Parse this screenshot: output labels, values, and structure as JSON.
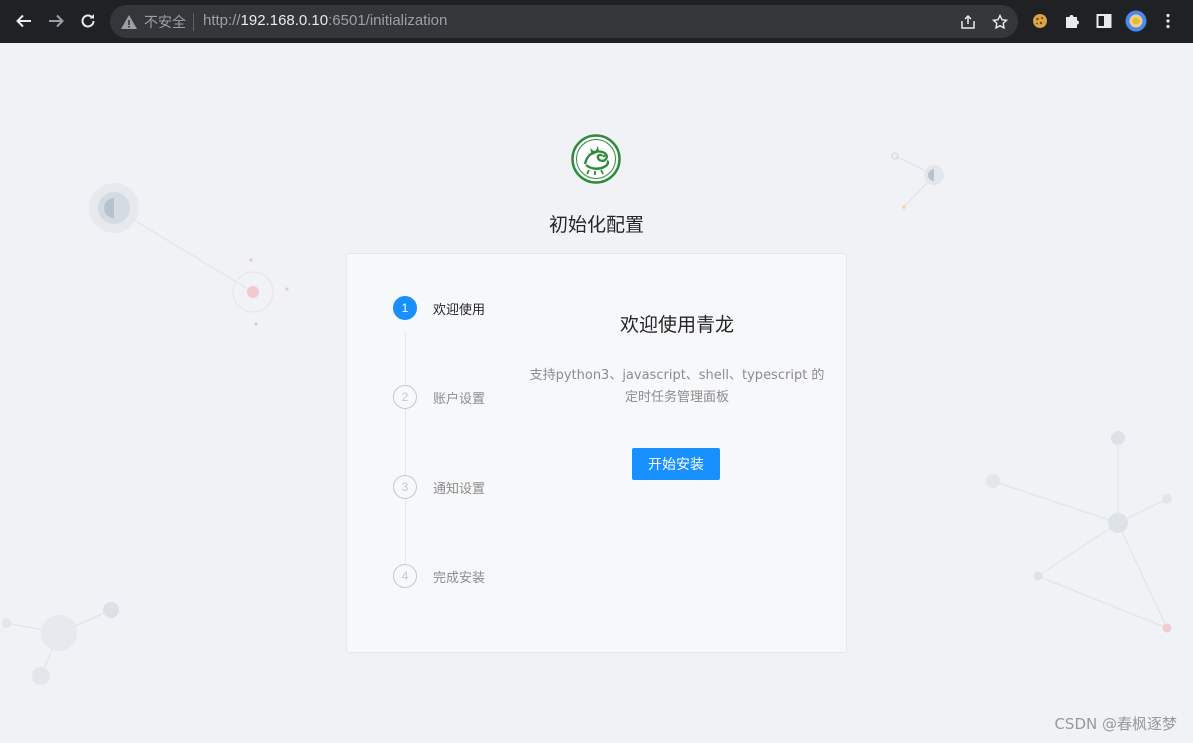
{
  "browser": {
    "security_label": "不安全",
    "url_prefix": "http://",
    "url_host": "192.168.0.10",
    "url_rest": ":6501/initialization"
  },
  "page": {
    "title": "初始化配置",
    "steps": [
      {
        "number": "1",
        "label": "欢迎使用",
        "active": true
      },
      {
        "number": "2",
        "label": "账户设置",
        "active": false
      },
      {
        "number": "3",
        "label": "通知设置",
        "active": false
      },
      {
        "number": "4",
        "label": "完成安装",
        "active": false
      }
    ],
    "welcome_title": "欢迎使用青龙",
    "description_line1": "支持python3、javascript、shell、typescript 的",
    "description_line2": "定时任务管理面板",
    "start_button": "开始安装"
  },
  "watermark": "CSDN @春枫逐梦",
  "colors": {
    "primary": "#1890ff",
    "background": "#f0f2f5",
    "logo_green": "#2e8b3c"
  }
}
